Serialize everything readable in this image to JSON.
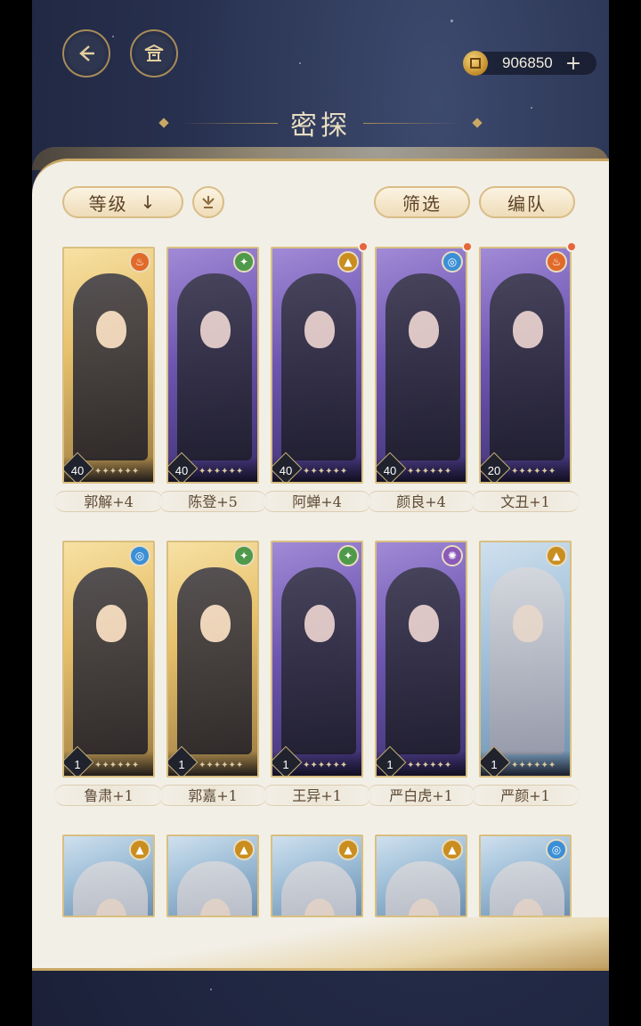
{
  "currency": {
    "amount": "906850",
    "plus": "+"
  },
  "header": {
    "title": "密探"
  },
  "toolbar": {
    "sort_label": "等级",
    "sort_arrow": "↓",
    "filter_label": "筛选",
    "team_label": "编队"
  },
  "cards": [
    {
      "name": "郭解+4",
      "level": "40",
      "element": "fire-icon",
      "rarity": "gold",
      "new": false
    },
    {
      "name": "陈登+5",
      "level": "40",
      "element": "wood-icon",
      "rarity": "purple",
      "new": false
    },
    {
      "name": "阿蝉+4",
      "level": "40",
      "element": "earth-icon",
      "rarity": "purple",
      "new": true
    },
    {
      "name": "颜良+4",
      "level": "40",
      "element": "water-icon",
      "rarity": "purple",
      "new": true
    },
    {
      "name": "文丑+1",
      "level": "20",
      "element": "fire-icon",
      "rarity": "purple",
      "new": true
    },
    {
      "name": "鲁肃+1",
      "level": "1",
      "element": "water-icon",
      "rarity": "gold",
      "new": false
    },
    {
      "name": "郭嘉+1",
      "level": "1",
      "element": "wood-icon",
      "rarity": "gold",
      "new": false
    },
    {
      "name": "王异+1",
      "level": "1",
      "element": "wood-icon",
      "rarity": "purple",
      "new": false
    },
    {
      "name": "严白虎+1",
      "level": "1",
      "element": "thunder-icon",
      "rarity": "purple",
      "new": false
    },
    {
      "name": "严颜+1",
      "level": "1",
      "element": "earth-icon",
      "rarity": "blue",
      "new": false
    },
    {
      "name": "",
      "level": "",
      "element": "earth-icon",
      "rarity": "blue",
      "new": false
    },
    {
      "name": "",
      "level": "",
      "element": "earth-icon",
      "rarity": "blue",
      "new": false
    },
    {
      "name": "",
      "level": "",
      "element": "earth-icon",
      "rarity": "blue",
      "new": false
    },
    {
      "name": "",
      "level": "",
      "element": "earth-icon",
      "rarity": "blue",
      "new": false
    },
    {
      "name": "",
      "level": "",
      "element": "water-icon",
      "rarity": "blue",
      "new": false
    }
  ],
  "colors": {
    "accent_gold": "#c7a863",
    "panel": "#f2efe7",
    "new_dot": "#e8643a"
  }
}
